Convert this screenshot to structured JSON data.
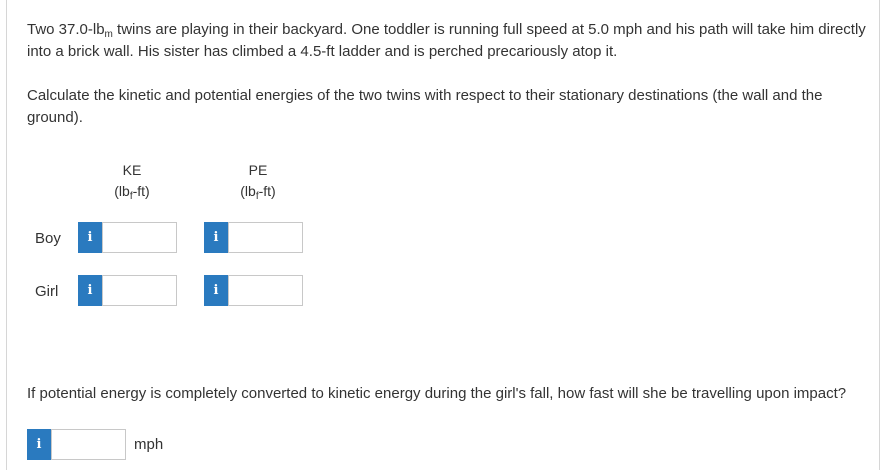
{
  "problem": {
    "intro_pre": "Two 37.0-lb",
    "intro_sub": "m",
    "intro_post": " twins are playing in their backyard. One toddler is running full speed at 5.0 mph and his path will take him directly into a brick wall. His sister has climbed a 4.5-ft ladder and is perched precariously atop it.",
    "question1": "Calculate the kinetic and potential energies of the two twins with respect to their stationary destinations (the wall and the ground).",
    "question2": "If potential energy is completely converted to kinetic energy during the girl's fall, how fast will she be travelling upon impact?"
  },
  "table": {
    "ke_header": "KE",
    "pe_header": "PE",
    "unit_pre": "(lb",
    "unit_sub": "f",
    "unit_post": "-ft)",
    "rows": [
      {
        "label": "Boy",
        "ke_value": "",
        "pe_value": ""
      },
      {
        "label": "Girl",
        "ke_value": "",
        "pe_value": ""
      }
    ]
  },
  "speed": {
    "value": "",
    "unit": "mph"
  },
  "info_icon_glyph": "i",
  "colors": {
    "info_button": "#2a7abf",
    "input_border": "#c8c8c8",
    "text": "#333333"
  }
}
